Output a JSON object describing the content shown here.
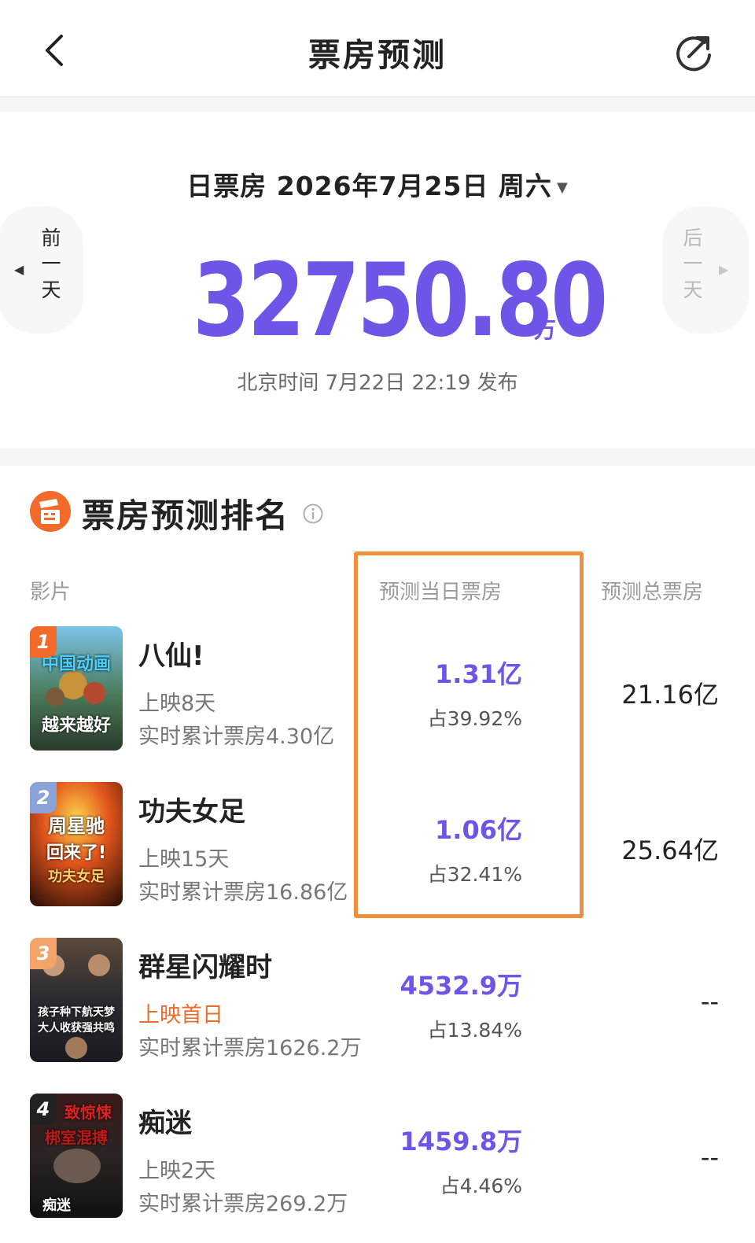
{
  "header": {
    "title": "票房预测"
  },
  "daily": {
    "date_label": "日票房 2026年7月25日 周六",
    "prev_day_label": [
      "前",
      "一",
      "天"
    ],
    "next_day_label": [
      "后",
      "一",
      "天"
    ],
    "total_value": "32750.80",
    "total_unit": "万",
    "publish_time": "北京时间 7月22日 22:19 发布"
  },
  "ranking": {
    "title": "票房预测排名",
    "columns": {
      "film": "影片",
      "day_forecast": "预测当日票房",
      "total_forecast": "预测总票房"
    },
    "films": [
      {
        "rank": "1",
        "name": "八仙!",
        "days": "上映8天",
        "cumulative": "实时累计票房4.30亿",
        "day_forecast": "1.31亿",
        "share": "占39.92%",
        "total_forecast": "21.16亿",
        "poster_text": [
          "中国动画",
          "越来越好"
        ]
      },
      {
        "rank": "2",
        "name": "功夫女足",
        "days": "上映15天",
        "cumulative": "实时累计票房16.86亿",
        "day_forecast": "1.06亿",
        "share": "占32.41%",
        "total_forecast": "25.64亿",
        "poster_text": [
          "周星驰",
          "回来了!",
          "功夫女足"
        ]
      },
      {
        "rank": "3",
        "name": "群星闪耀时",
        "days": "上映首日",
        "cumulative": "实时累计票房1626.2万",
        "day_forecast": "4532.9万",
        "share": "占13.84%",
        "total_forecast": "--",
        "poster_text": [
          "孩子种下航天梦",
          "大人收获强共鸣"
        ]
      },
      {
        "rank": "4",
        "name": "痴迷",
        "days": "上映2天",
        "cumulative": "实时累计票房269.2万",
        "day_forecast": "1459.8万",
        "share": "占4.46%",
        "total_forecast": "--",
        "poster_text": [
          "致惊悚",
          "梆室混搏",
          "痴迷"
        ]
      }
    ]
  },
  "colors": {
    "accent_purple": "#6f54e8",
    "highlight_orange": "#f08f3c",
    "first_day_orange": "#f26b2a"
  },
  "icons": [
    "back-arrow-icon",
    "share-icon",
    "caret-down-icon",
    "clapperboard-icon",
    "info-icon"
  ]
}
